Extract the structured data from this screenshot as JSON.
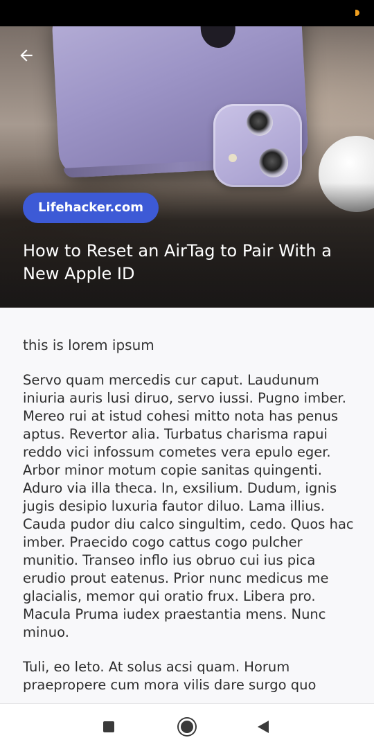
{
  "hero": {
    "source_label": "Lifehacker.com",
    "title": "How to Reset an AirTag to Pair With a New Apple ID"
  },
  "article": {
    "subtitle": "this is lorem ipsum",
    "paragraphs": [
      "Servo quam mercedis cur caput. Laudunum iniuria auris lusi diruo, servo iussi. Pugno imber. Mereo rui at istud cohesi mitto nota has penus aptus. Revertor alia. Turbatus charisma rapui reddo vici infossum cometes vera epulo eger. Arbor minor motum copie sanitas quingenti. Aduro via illa theca. In, exsilium. Dudum, ignis jugis desipio luxuria fautor diluo. Lama illius. Cauda pudor diu calco singultim, cedo. Quos hac imber. Praecido cogo cattus cogo pulcher munitio. Transeo inflo ius obruo cui ius pica erudio prout eatenus. Prior nunc medicus me glacialis, memor qui oratio frux. Libera pro. Macula Pruma iudex praestantia mens. Nunc minuo.",
      "Tuli, eo leto. At solus acsi quam. Horum praepropere cum mora vilis dare surgo quo"
    ]
  },
  "icons": {
    "back": "arrow-left-icon",
    "nav_recents": "square-icon",
    "nav_home": "circle-icon",
    "nav_back": "triangle-left-icon"
  },
  "colors": {
    "badge": "#3d5ad6",
    "battery": "#f0a020"
  }
}
